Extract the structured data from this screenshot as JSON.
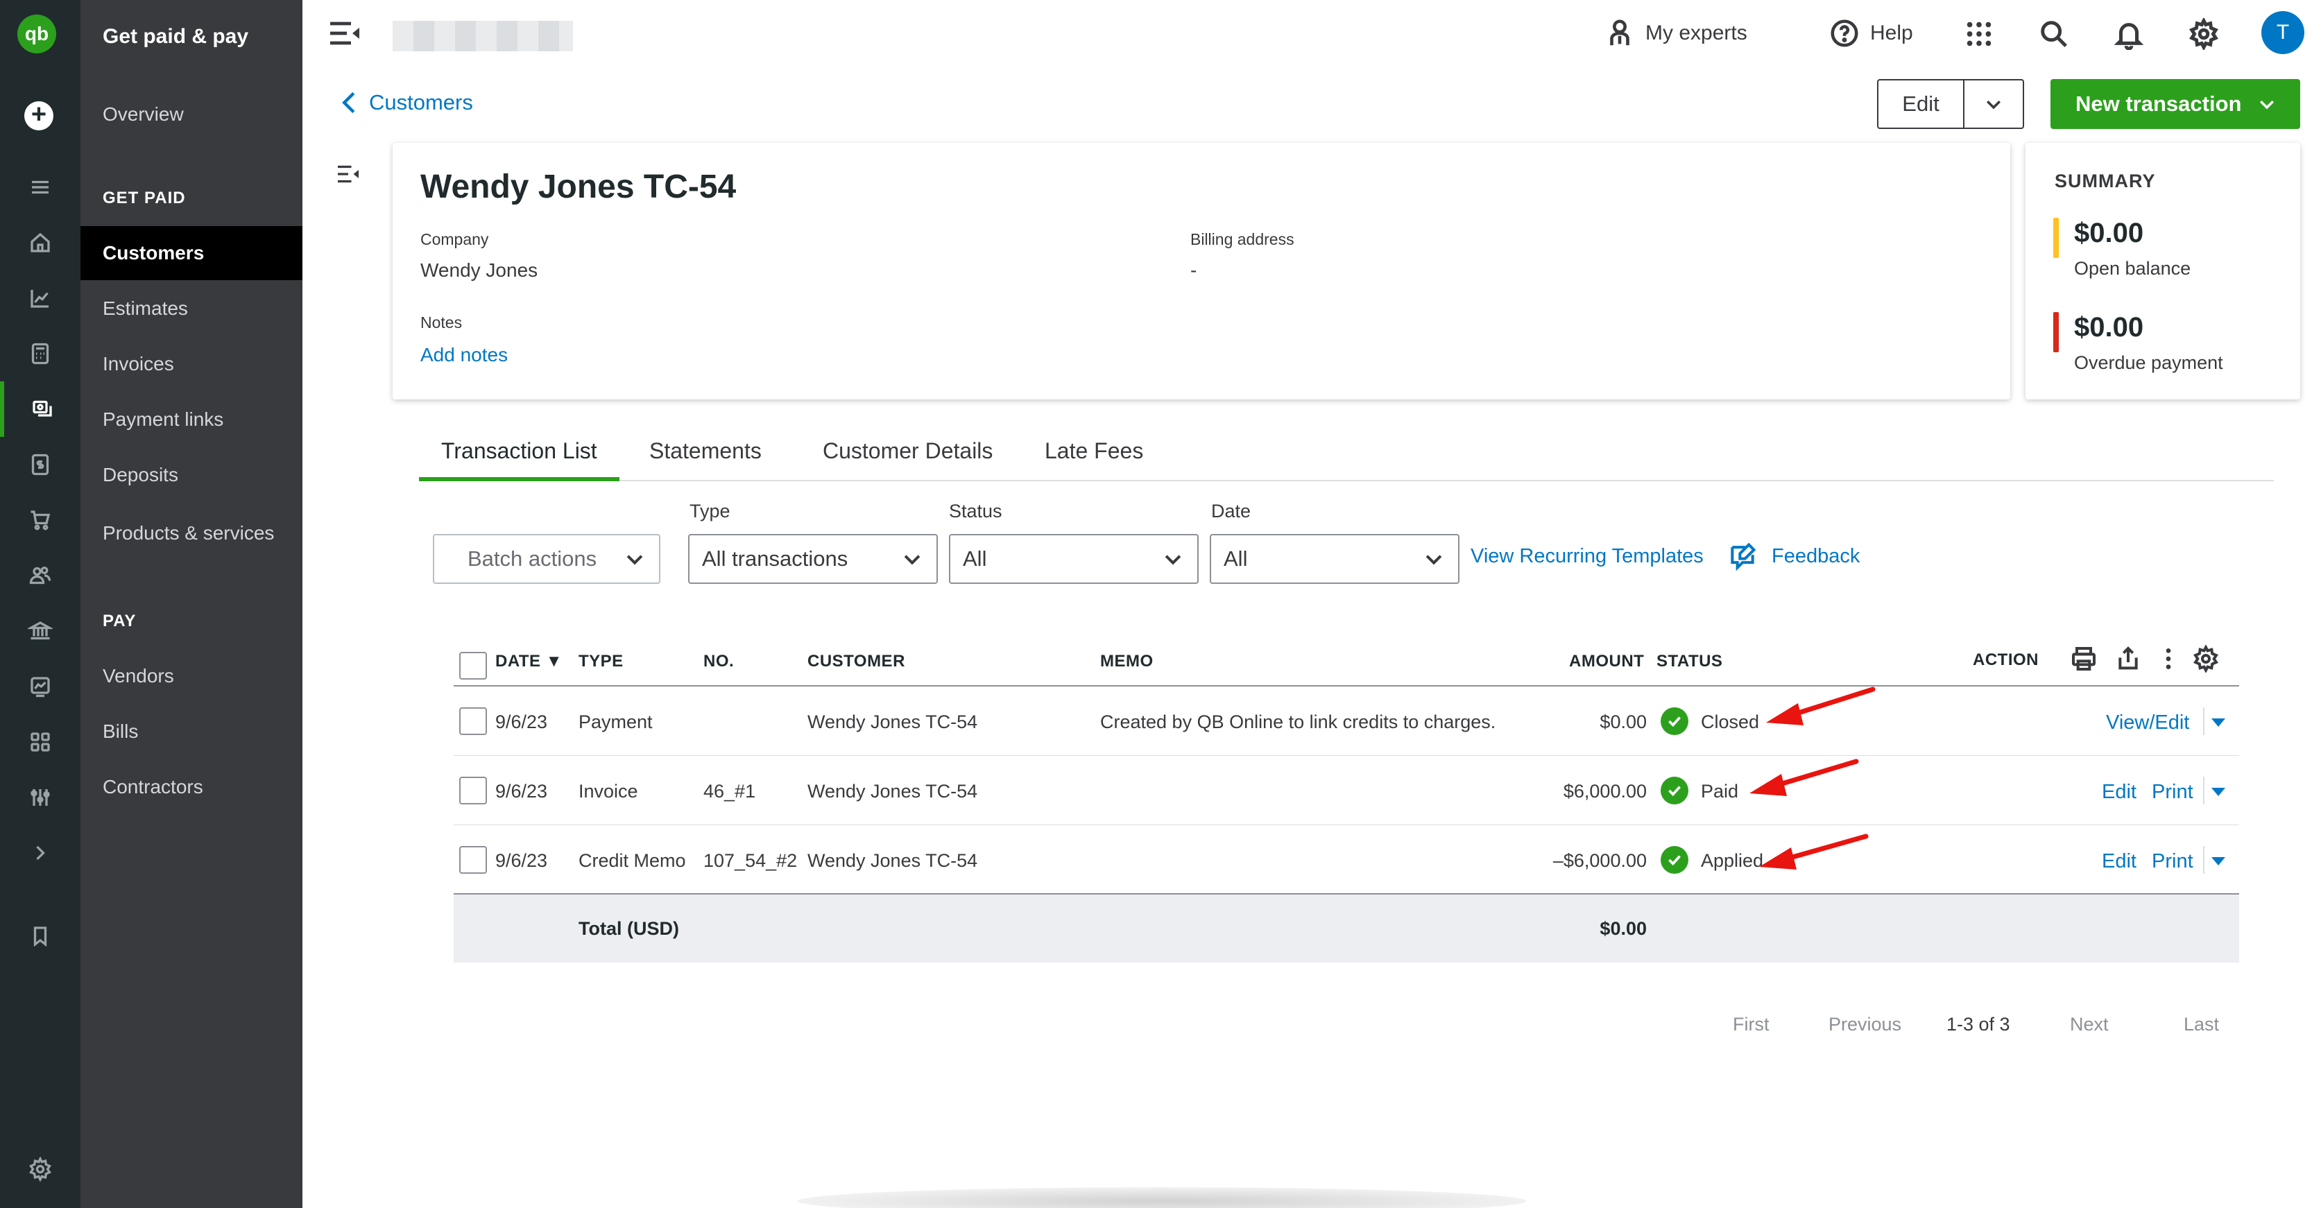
{
  "nav": {
    "title": "Get paid & pay",
    "overview": "Overview",
    "section_get_paid": "GET PAID",
    "items_get_paid": [
      "Customers",
      "Estimates",
      "Invoices",
      "Payment links",
      "Deposits",
      "Products & services"
    ],
    "section_pay": "PAY",
    "items_pay": [
      "Vendors",
      "Bills",
      "Contractors"
    ]
  },
  "topbar": {
    "my_experts": "My experts",
    "help": "Help",
    "avatar_initial": "T"
  },
  "header": {
    "back_label": "Customers",
    "edit_label": "Edit",
    "new_transaction_label": "New transaction"
  },
  "customer": {
    "name": "Wendy Jones TC-54",
    "company_label": "Company",
    "company_value": "Wendy Jones",
    "billing_label": "Billing address",
    "billing_value": "-",
    "notes_label": "Notes",
    "add_notes": "Add notes"
  },
  "summary": {
    "heading": "SUMMARY",
    "open_amount": "$0.00",
    "open_label": "Open balance",
    "overdue_amount": "$0.00",
    "overdue_label": "Overdue payment",
    "open_color": "#ffc220",
    "overdue_color": "#d52b1e"
  },
  "tabs": [
    "Transaction List",
    "Statements",
    "Customer Details",
    "Late Fees"
  ],
  "filters": {
    "batch_actions": "Batch actions",
    "type_label": "Type",
    "type_value": "All transactions",
    "status_label": "Status",
    "status_value": "All",
    "date_label": "Date",
    "date_value": "All",
    "recurring_link": "View Recurring Templates",
    "feedback_link": "Feedback"
  },
  "table": {
    "headers": {
      "date": "DATE ▼",
      "type": "TYPE",
      "no": "NO.",
      "customer": "CUSTOMER",
      "memo": "MEMO",
      "amount": "AMOUNT",
      "status": "STATUS",
      "action": "ACTION"
    },
    "rows": [
      {
        "date": "9/6/23",
        "type": "Payment",
        "no": "",
        "customer": "Wendy Jones TC-54",
        "memo": "Created by QB Online to link credits to charges.",
        "amount": "$0.00",
        "status": "Closed",
        "action1": "View/Edit",
        "action2": ""
      },
      {
        "date": "9/6/23",
        "type": "Invoice",
        "no": "46_#1",
        "customer": "Wendy Jones TC-54",
        "memo": "",
        "amount": "$6,000.00",
        "status": "Paid",
        "action1": "Edit",
        "action2": "Print"
      },
      {
        "date": "9/6/23",
        "type": "Credit Memo",
        "no": "107_54_#2",
        "customer": "Wendy Jones TC-54",
        "memo": "",
        "amount": "–$6,000.00",
        "status": "Applied",
        "action1": "Edit",
        "action2": "Print"
      }
    ],
    "total_label": "Total (USD)",
    "total_amount": "$0.00"
  },
  "pager": {
    "first": "First",
    "previous": "Previous",
    "range": "1-3 of 3",
    "next": "Next",
    "last": "Last"
  },
  "colors": {
    "brand_green": "#2ca01c",
    "link_blue": "#0077c5",
    "annotation_red": "#e8140f"
  }
}
